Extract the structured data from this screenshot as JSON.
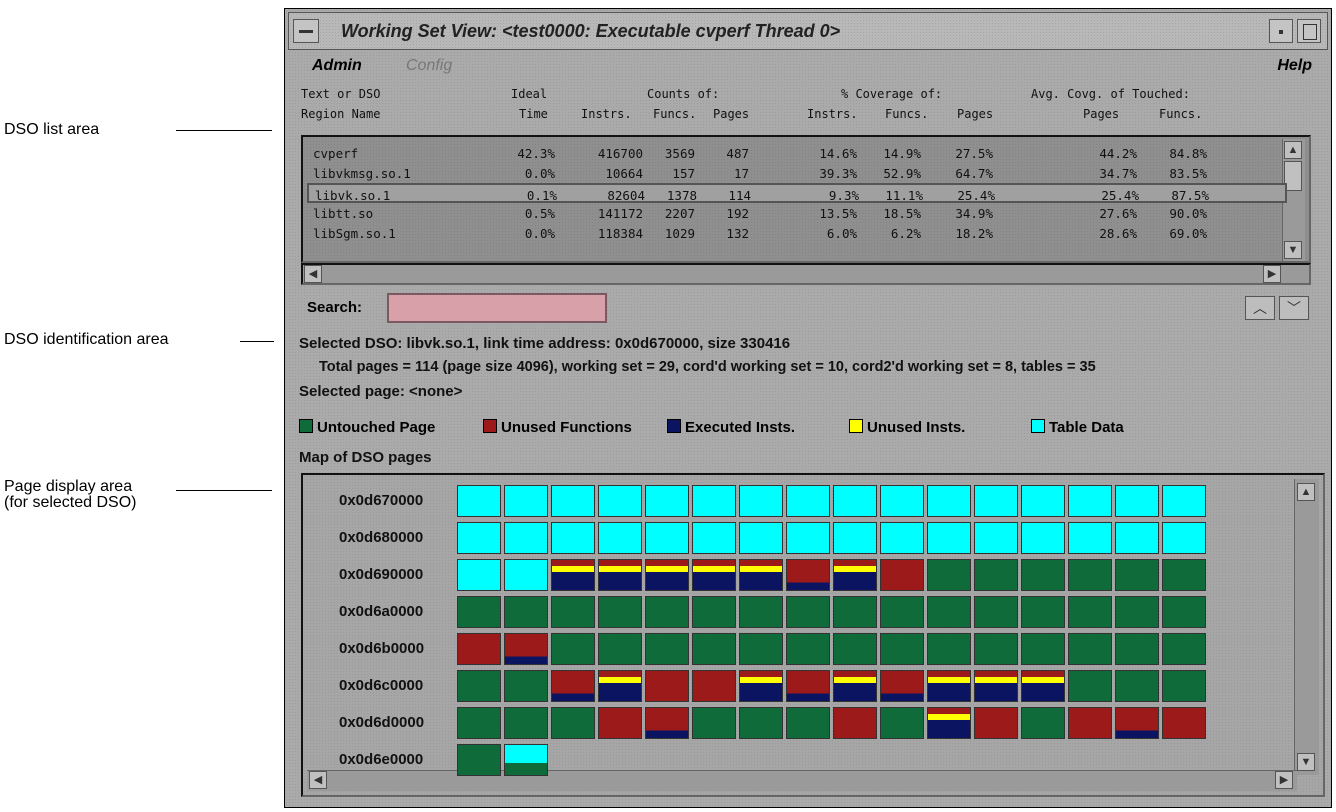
{
  "callouts": {
    "list": "DSO list area",
    "ident": "DSO identification area",
    "page1": "Page display area",
    "page2": "(for selected DSO)"
  },
  "window": {
    "title": "Working Set View: <test0000: Executable cvperf Thread 0>"
  },
  "menu": {
    "admin": "Admin",
    "config": "Config",
    "help": "Help"
  },
  "list_header": {
    "row1": [
      "Text or DSO",
      "Ideal",
      "Counts of:",
      "% Coverage of:",
      "Avg. Covg. of Touched:"
    ],
    "row2": [
      "Region Name",
      "Time",
      "Instrs.",
      "Funcs.",
      "Pages",
      "Instrs.",
      "Funcs.",
      "Pages",
      "Pages",
      "Funcs."
    ]
  },
  "dso_rows": [
    [
      "cvperf",
      "42.3%",
      "416700",
      "3569",
      "487",
      "14.6%",
      "14.9%",
      "27.5%",
      "44.2%",
      "84.8%"
    ],
    [
      "libvkmsg.so.1",
      "0.0%",
      "10664",
      "157",
      "17",
      "39.3%",
      "52.9%",
      "64.7%",
      "34.7%",
      "83.5%"
    ],
    [
      "libvk.so.1",
      "0.1%",
      "82604",
      "1378",
      "114",
      "9.3%",
      "11.1%",
      "25.4%",
      "25.4%",
      "87.5%"
    ],
    [
      "libtt.so",
      "0.5%",
      "141172",
      "2207",
      "192",
      "13.5%",
      "18.5%",
      "34.9%",
      "27.6%",
      "90.0%"
    ],
    [
      "libSgm.so.1",
      "0.0%",
      "118384",
      "1029",
      "132",
      "6.0%",
      "6.2%",
      "18.2%",
      "28.6%",
      "69.0%"
    ]
  ],
  "search": {
    "label": "Search:",
    "value": ""
  },
  "info": {
    "selected_dso": "Selected DSO: libvk.so.1, link time address: 0x0d670000, size 330416",
    "totals": "Total pages = 114 (page size 4096), working set = 29, cord'd working set = 10, cord2'd working set = 8, tables = 35",
    "selected_page": "Selected page: <none>"
  },
  "legend": [
    {
      "label": "Untouched Page",
      "color": "#0f6b3a"
    },
    {
      "label": "Unused Functions",
      "color": "#9c1a1a"
    },
    {
      "label": "Executed Insts.",
      "color": "#0b1460"
    },
    {
      "label": "Unused Insts.",
      "color": "#ffff00"
    },
    {
      "label": "Table Data",
      "color": "#00ffff"
    }
  ],
  "map_title": "Map of DSO pages",
  "page_map": {
    "colors": {
      "T": "#00ffff",
      "G": "#0f6b3a",
      "R": "#9c1a1a",
      "B": "#0b1460",
      "Y": "#ffff00"
    },
    "rows": [
      {
        "addr": "0x0d670000",
        "pages": [
          "T",
          "T",
          "T",
          "T",
          "T",
          "T",
          "T",
          "T",
          "T",
          "T",
          "T",
          "T",
          "T",
          "T",
          "T",
          "T"
        ]
      },
      {
        "addr": "0x0d680000",
        "pages": [
          "T",
          "T",
          "T",
          "T",
          "T",
          "T",
          "T",
          "T",
          "T",
          "T",
          "T",
          "T",
          "T",
          "T",
          "T",
          "T"
        ]
      },
      {
        "addr": "0x0d690000",
        "pages": [
          "T",
          "T",
          "RYB",
          "RYB",
          "RYB",
          "RYB",
          "RYB",
          "RB",
          "RYB",
          "R",
          "G",
          "G",
          "G",
          "G",
          "G",
          "G"
        ]
      },
      {
        "addr": "0x0d6a0000",
        "pages": [
          "G",
          "G",
          "G",
          "G",
          "G",
          "G",
          "G",
          "G",
          "G",
          "G",
          "G",
          "G",
          "G",
          "G",
          "G",
          "G"
        ]
      },
      {
        "addr": "0x0d6b0000",
        "pages": [
          "R",
          "RB",
          "G",
          "G",
          "G",
          "G",
          "G",
          "G",
          "G",
          "G",
          "G",
          "G",
          "G",
          "G",
          "G",
          "G"
        ]
      },
      {
        "addr": "0x0d6c0000",
        "pages": [
          "G",
          "G",
          "RB",
          "RYB",
          "R",
          "R",
          "RYB",
          "RB",
          "RYB",
          "RB",
          "RYB",
          "RYB",
          "RYB",
          "G",
          "G",
          "G"
        ]
      },
      {
        "addr": "0x0d6d0000",
        "pages": [
          "G",
          "G",
          "G",
          "R",
          "RB",
          "G",
          "G",
          "G",
          "R",
          "G",
          "RYB",
          "R",
          "G",
          "R",
          "RB",
          "R"
        ]
      },
      {
        "addr": "0x0d6e0000",
        "pages": [
          "G",
          "TG"
        ]
      }
    ]
  }
}
